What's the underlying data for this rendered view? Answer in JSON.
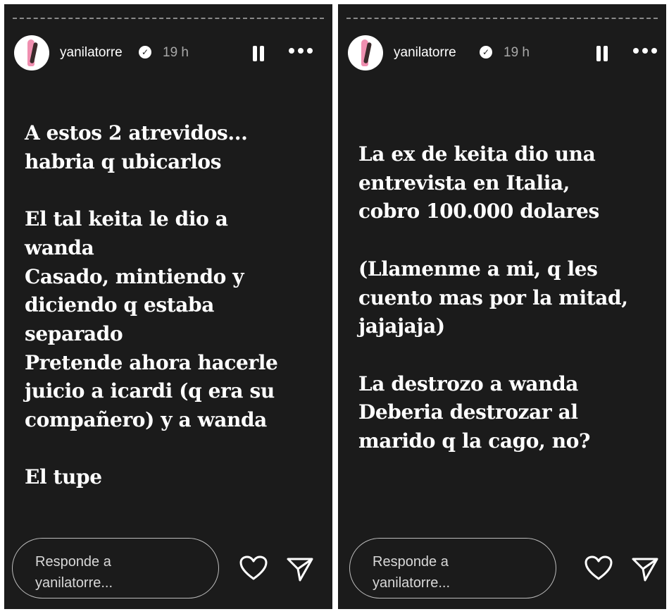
{
  "stories": [
    {
      "header": {
        "username": "yanilatorre",
        "verified_mark": "✓",
        "time": "19 h",
        "avatar_icon": "profile-avatar"
      },
      "text": "A estos 2 atrevidos...\nhabria q ubicarlos\n\nEl tal keita le dio a\nwanda\nCasado, mintiendo y\ndiciendo q estaba\nseparado\nPretende ahora hacerle\njuicio a icardi (q era su\ncompañero) y a wanda\n\nEl tupe",
      "reply_placeholder": "Responde a\nyanilatorre..."
    },
    {
      "header": {
        "username": "yanilatorre",
        "verified_mark": "✓",
        "time": "19 h",
        "avatar_icon": "profile-avatar"
      },
      "text": "La ex de keita dio una\nentrevista en Italia,\ncobro 100.000 dolares\n\n(Llamenme a mi, q les\ncuento mas por la mitad,\njajajaja)\n\nLa destrozo a wanda\nDeberia destrozar al\nmarido q la cago, no?",
      "reply_placeholder": "Responde a\nyanilatorre..."
    }
  ],
  "icons": {
    "pause": "pause-icon",
    "more": "more-options-icon",
    "like": "heart-icon",
    "share": "send-icon"
  },
  "colors": {
    "background": "#1b1b1b",
    "text": "#ffffff",
    "muted": "#a8a8a8"
  }
}
